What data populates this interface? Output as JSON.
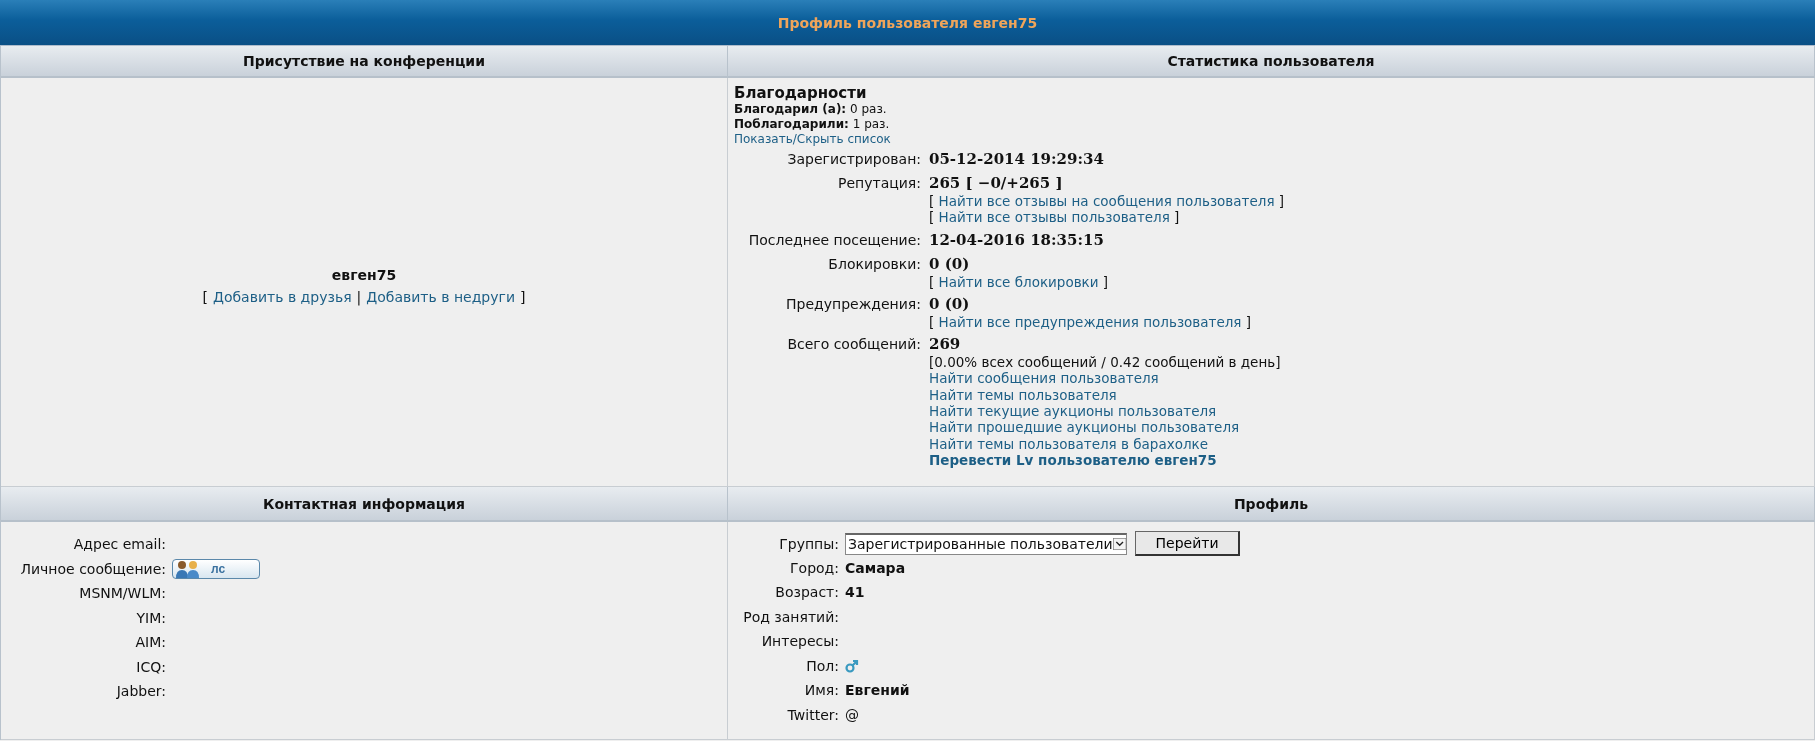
{
  "title": "Профиль пользователя евген75",
  "presence": {
    "header": "Присутствие на конференции",
    "username": "евген75",
    "actions": {
      "open": "[",
      "links": [
        "Добавить в друзья",
        "Добавить в недруги"
      ],
      "separator": "|",
      "close": "]"
    }
  },
  "stats": {
    "header": "Статистика пользователя",
    "thanks": {
      "heading": "Благодарности",
      "rows": [
        {
          "label": "Благодарил (а):",
          "value": "0 раз."
        },
        {
          "label": "Поблагодарили:",
          "value": "1 раз."
        }
      ],
      "toggle": "Показать/Скрыть список"
    },
    "rows": [
      {
        "label": "Зарегистрирован:",
        "value": "05-12-2014 19:29:34",
        "lines": []
      },
      {
        "label": "Репутация:",
        "value": "265 [ −0/+265 ]",
        "lines": [
          {
            "kind": "bracket_link",
            "open": "[",
            "text": "Найти все отзывы на сообщения пользователя",
            "close": "]"
          },
          {
            "kind": "bracket_link",
            "open": "[",
            "text": "Найти все отзывы пользователя",
            "close": "]"
          }
        ]
      },
      {
        "label": "Последнее посещение:",
        "value": "12-04-2016 18:35:15",
        "lines": []
      },
      {
        "label": "Блокировки:",
        "value": "0 (0)",
        "lines": [
          {
            "kind": "bracket_link",
            "open": "[",
            "text": "Найти все блокировки",
            "close": "]"
          }
        ]
      },
      {
        "label": "Предупреждения:",
        "value": "0 (0)",
        "lines": [
          {
            "kind": "bracket_link",
            "open": "[",
            "text": "Найти все предупреждения пользователя",
            "close": "]"
          }
        ]
      },
      {
        "label": "Всего сообщений:",
        "value": "269",
        "lines": [
          {
            "kind": "text",
            "text": "[0.00% всех сообщений / 0.42 сообщений в день]"
          },
          {
            "kind": "link",
            "text": "Найти сообщения пользователя"
          },
          {
            "kind": "link",
            "text": "Найти темы пользователя"
          },
          {
            "kind": "link",
            "text": "Найти текущие аукционы пользователя"
          },
          {
            "kind": "link",
            "text": "Найти прошедшие аукционы пользователя"
          },
          {
            "kind": "link",
            "text": "Найти темы пользователя в барахолке"
          },
          {
            "kind": "strong_link",
            "text": "Перевести Lv пользователю евген75"
          }
        ]
      }
    ]
  },
  "contacts": {
    "header": "Контактная информация",
    "rows": [
      {
        "label": "Адрес email:",
        "kind": "empty"
      },
      {
        "label": "Личное сообщение:",
        "kind": "pm_button",
        "value": "лс"
      },
      {
        "label": "MSNM/WLM:",
        "kind": "empty"
      },
      {
        "label": "YIM:",
        "kind": "empty"
      },
      {
        "label": "AIM:",
        "kind": "empty"
      },
      {
        "label": "ICQ:",
        "kind": "empty"
      },
      {
        "label": "Jabber:",
        "kind": "empty"
      }
    ]
  },
  "profile": {
    "header": "Профиль",
    "rows": [
      {
        "label": "Группы:",
        "kind": "select",
        "value": "Зарегистрированные пользователи",
        "button": "Перейти"
      },
      {
        "label": "Город:",
        "kind": "bold",
        "value": "Самара"
      },
      {
        "label": "Возраст:",
        "kind": "bold",
        "value": "41"
      },
      {
        "label": "Род занятий:",
        "kind": "empty"
      },
      {
        "label": "Интересы:",
        "kind": "empty"
      },
      {
        "label": "Пол:",
        "kind": "male"
      },
      {
        "label": "Имя:",
        "kind": "bold",
        "value": "Евгений"
      },
      {
        "label": "Twitter:",
        "kind": "text",
        "value": "@"
      }
    ]
  }
}
